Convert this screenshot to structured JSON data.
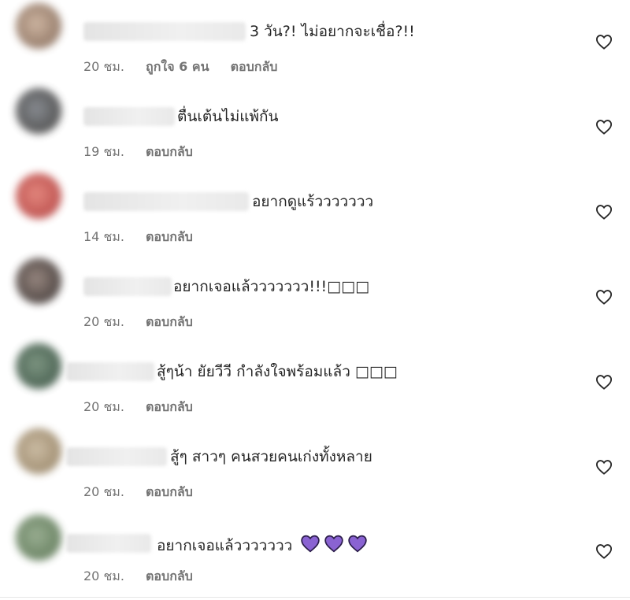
{
  "comments": [
    {
      "text": "3 วัน?! ไม่อยากจะเชื่อ?!!",
      "time": "20 ชม.",
      "likes": "ถูกใจ 6 คน",
      "reply": "ตอบกลับ",
      "avatar_color": "#9a7f6c"
    },
    {
      "text": "ตื่นเต้นไม่แพ้กัน",
      "time": "19 ชม.",
      "reply": "ตอบกลับ",
      "avatar_color": "#4a4e53"
    },
    {
      "text": "อยากดูแร้ววววววว",
      "time": "14 ชม.",
      "reply": "ตอบกลับ",
      "avatar_color": "#c0504f"
    },
    {
      "text": "อยากเจอแล้ววววววว!!!□□□",
      "time": "20 ชม.",
      "reply": "ตอบกลับ",
      "avatar_color": "#3d3330"
    },
    {
      "text": "สู้ๆน้า ยัยวีวี กำลังใจพร้อมแล้ว □□□",
      "time": "20 ชม.",
      "reply": "ตอบกลับ",
      "avatar_color": "#3f5a47"
    },
    {
      "text": "สู้ๆ สาวๆ คนสวยคนเก่งทั้งหลาย",
      "time": "20 ชม.",
      "reply": "ตอบกลับ",
      "avatar_color": "#9d8b6f"
    },
    {
      "text": "อยากเจอแล้ววววววว",
      "time": "20 ชม.",
      "reply": "ตอบกลับ",
      "avatar_color": "#5f7a58",
      "emoji": "purple-heart x3"
    }
  ],
  "colors": {
    "text": "#262626",
    "meta": "#737373",
    "purple_heart": "#8a63d2"
  }
}
